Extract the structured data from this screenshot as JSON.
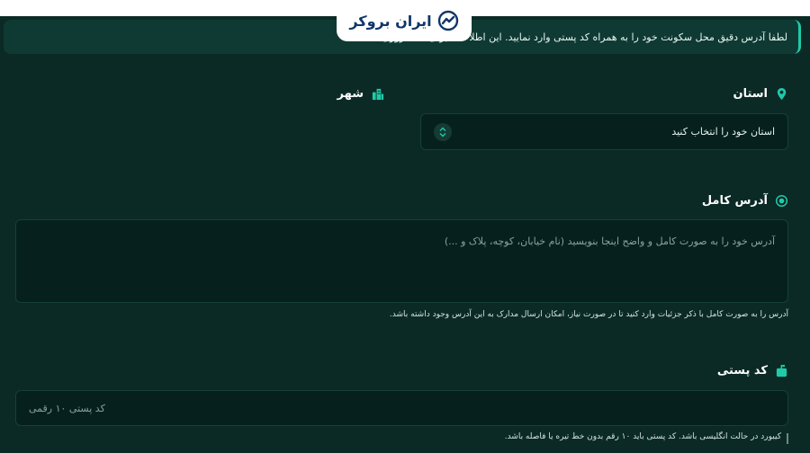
{
  "brand": {
    "name": "ایران بروکر"
  },
  "notice": {
    "text": "لطفا آدرس دقیق محل سکونت خود را به همراه کد پستی وارد نمایید. این اطلاعات برای ... ضروری است."
  },
  "province": {
    "label": "استان",
    "placeholder": "استان خود را انتخاب کنید"
  },
  "city": {
    "label": "شهر"
  },
  "address": {
    "label": "آدرس کامل",
    "placeholder": "آدرس خود را به صورت کامل و واضح اینجا بنویسید (نام خیابان، کوچه، پلاک و ...)",
    "hint": "آدرس را به صورت کامل با ذکر جزئیات وارد کنید تا در صورت نیاز، امکان ارسال مدارک به این آدرس وجود داشته باشد."
  },
  "postal": {
    "label": "کد پستی",
    "placeholder": "کد پستی ۱۰ رقمی",
    "hint": "کیبورد در حالت انگلیسی باشد. کد پستی باید ۱۰ رقم بدون خط تیره یا فاصله باشد."
  },
  "colors": {
    "background": "#0b2a25",
    "accent": "#20c9a8",
    "field": "#06211d"
  },
  "icons": [
    "location-pin-icon",
    "city-buildings-icon",
    "target-icon",
    "mailbox-icon",
    "chevron-updown-icon",
    "brand-logo-icon"
  ]
}
